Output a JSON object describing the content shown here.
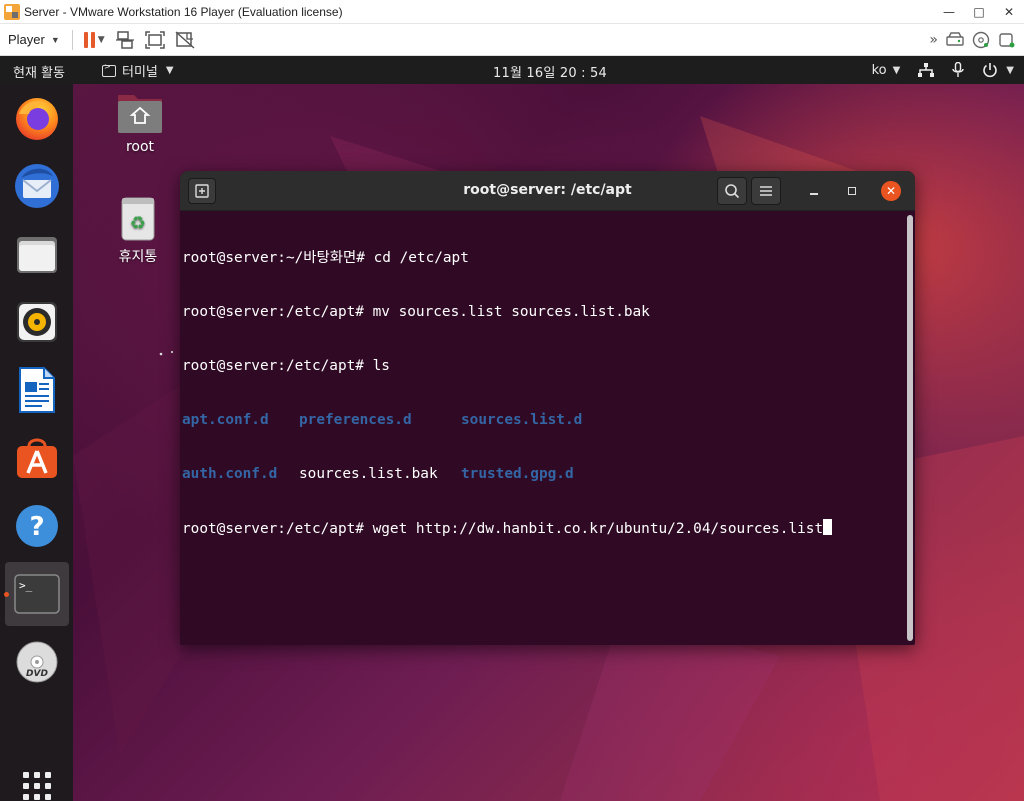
{
  "vmware": {
    "title": "Server - VMware Workstation 16 Player (Evaluation license)",
    "player_label": "Player",
    "icons": [
      "vmware-logo-icon",
      "minimize-icon",
      "maximize-icon",
      "close-icon",
      "pause-icon",
      "send-ctrl-alt-del-icon",
      "fit-guest-icon",
      "unity-icon",
      "forward-arrows-icon",
      "hdd-icon",
      "network-icon",
      "audio-icon"
    ]
  },
  "gnome": {
    "activities": "현재 활동",
    "app_menu": "터미널",
    "clock": "11월 16일  20 : 54",
    "lang": "ko"
  },
  "desktop": {
    "home_label": "root",
    "trash_label": "휴지통"
  },
  "dock": {
    "items": [
      "firefox",
      "thunderbird",
      "files",
      "rhythmbox",
      "libreoffice-writer",
      "ubuntu-software",
      "help",
      "terminal",
      "dvd",
      "show-applications"
    ]
  },
  "terminal": {
    "title": "root@server: /etc/apt",
    "lines": {
      "l1": "root@server:~/바탕화면# cd /etc/apt",
      "l2": "root@server:/etc/apt# mv sources.list sources.list.bak",
      "l3": "root@server:/etc/apt# ls",
      "l4a": "apt.conf.d",
      "l4b": "preferences.d",
      "l4c": "sources.list.d",
      "l5a": "auth.conf.d",
      "l5b": "sources.list.bak",
      "l5c": "trusted.gpg.d",
      "l6": "root@server:/etc/apt# wget http://dw.hanbit.co.kr/ubuntu/2.04/sources.list"
    }
  },
  "colors": {
    "terminal_bg": "#300a24",
    "dir_blue": "#3465a4",
    "ubuntu_orange": "#e95420"
  }
}
